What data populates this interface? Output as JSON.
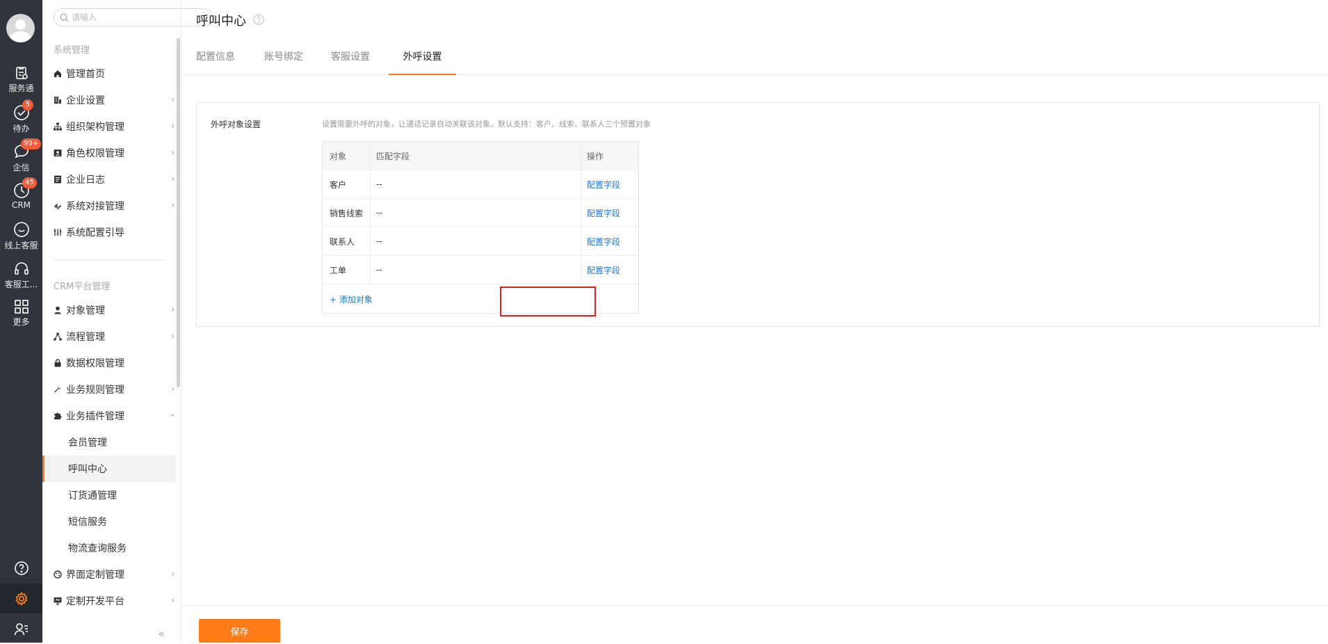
{
  "rail": {
    "items": [
      {
        "label": "服务通",
        "icon": "service-clipboard-icon"
      },
      {
        "label": "待办",
        "icon": "todo-check-icon",
        "badge": "5"
      },
      {
        "label": "企信",
        "icon": "chat-bubble-icon",
        "badge": "99+"
      },
      {
        "label": "CRM",
        "icon": "clock-icon",
        "badge": "45"
      },
      {
        "label": "线上客服",
        "icon": "smile-chat-icon"
      },
      {
        "label": "客服工...",
        "icon": "headset-icon"
      },
      {
        "label": "更多",
        "icon": "grid-icon"
      }
    ],
    "bottom": [
      "help-icon",
      "settings-gear-icon",
      "user-list-icon"
    ],
    "accent": "#ff7b17"
  },
  "sidebar": {
    "search_placeholder": "请输入",
    "section1": "系统管理",
    "section1_items": [
      {
        "label": "管理首页",
        "icon": "home-icon",
        "chevron": false
      },
      {
        "label": "企业设置",
        "icon": "building-icon",
        "chevron": true
      },
      {
        "label": "组织架构管理",
        "icon": "org-tree-icon",
        "chevron": true
      },
      {
        "label": "角色权限管理",
        "icon": "id-card-icon",
        "chevron": true
      },
      {
        "label": "企业日志",
        "icon": "log-doc-icon",
        "chevron": true
      },
      {
        "label": "系统对接管理",
        "icon": "link-icon",
        "chevron": true
      },
      {
        "label": "系统配置引导",
        "icon": "sliders-icon",
        "chevron": false
      }
    ],
    "section2": "CRM平台管理",
    "section2_items": [
      {
        "label": "对象管理",
        "icon": "user-icon",
        "chevron": true
      },
      {
        "label": "流程管理",
        "icon": "flow-icon",
        "chevron": true
      },
      {
        "label": "数据权限管理",
        "icon": "lock-icon",
        "chevron": false
      },
      {
        "label": "业务规则管理",
        "icon": "wrench-icon",
        "chevron": true
      },
      {
        "label": "业务插件管理",
        "icon": "puzzle-icon",
        "chevron": "down"
      }
    ],
    "plugin_children": [
      "会员管理",
      "呼叫中心",
      "订货通管理",
      "短信服务",
      "物流查询服务"
    ],
    "active_child": "呼叫中心",
    "section3_items": [
      {
        "label": "界面定制管理",
        "icon": "palette-icon",
        "chevron": true
      },
      {
        "label": "定制开发平台",
        "icon": "monitor-icon",
        "chevron": true
      }
    ],
    "collapse_glyph": "«"
  },
  "main": {
    "title": "呼叫中心",
    "tabs": [
      {
        "label": "配置信息",
        "active": false
      },
      {
        "label": "账号绑定",
        "active": false
      },
      {
        "label": "客服设置",
        "active": false
      },
      {
        "label": "外呼设置",
        "active": true
      }
    ],
    "card": {
      "label": "外呼对象设置",
      "desc": "设置需要外呼的对象，让通话记录自动关联该对象。默认支持：客户、线索、联系人三个预置对象",
      "headers": [
        "对象",
        "匹配字段",
        "操作"
      ],
      "rows": [
        {
          "object": "客户",
          "field": "--",
          "action": "配置字段"
        },
        {
          "object": "销售线索",
          "field": "--",
          "action": "配置字段"
        },
        {
          "object": "联系人",
          "field": "--",
          "action": "配置字段"
        },
        {
          "object": "工单",
          "field": "--",
          "action": "配置字段"
        }
      ],
      "add_label": "+ 添加对象"
    },
    "save_label": "保存"
  }
}
